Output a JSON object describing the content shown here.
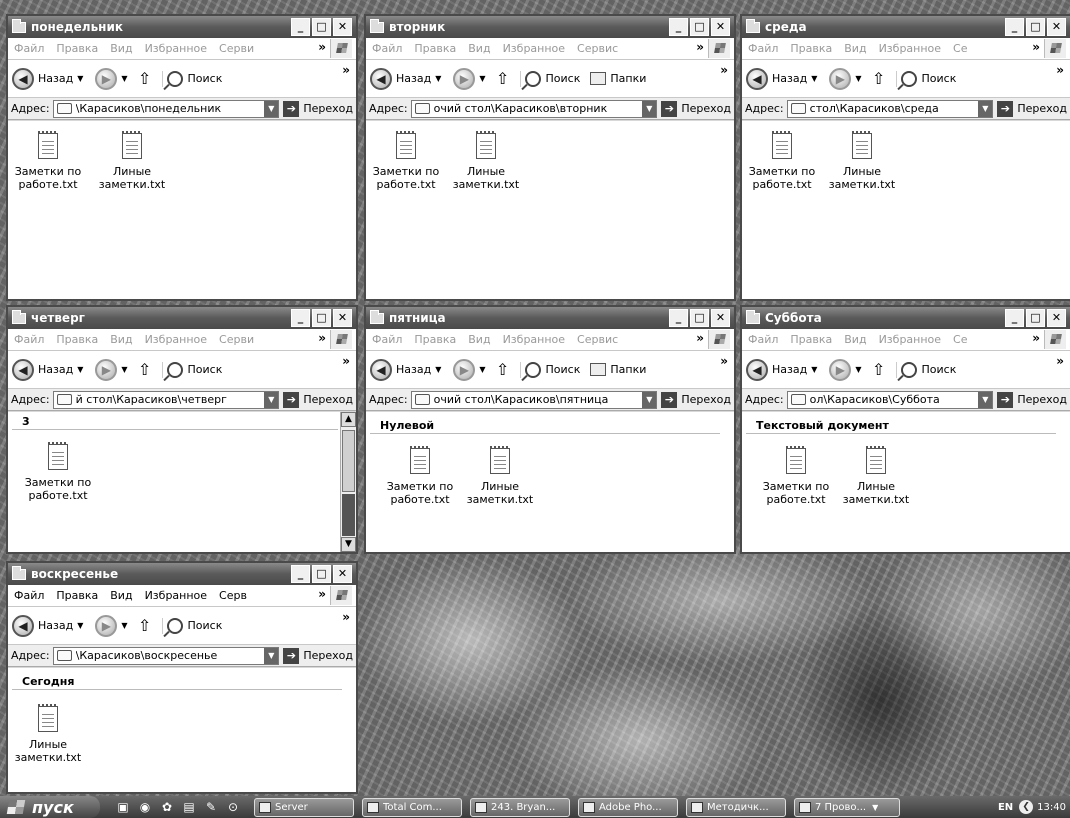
{
  "menu": {
    "file": "Файл",
    "edit": "Правка",
    "view": "Вид",
    "favorites": "Избранное"
  },
  "toolbar": {
    "back": "Назад",
    "search": "Поиск",
    "folders": "Папки",
    "more": "»"
  },
  "address": {
    "label": "Адрес:",
    "go": "Переход"
  },
  "windows": [
    {
      "title": "понедельник",
      "menu_service": "Серви",
      "address": "\\Карасиков\\понедельник",
      "group": "",
      "files": [
        {
          "line1": "Заметки по",
          "line2": "работе.txt"
        },
        {
          "line1": "Линые",
          "line2": "заметки.txt"
        }
      ]
    },
    {
      "title": "вторник",
      "menu_service": "Сервис",
      "address": "очий стол\\Карасиков\\вторник",
      "group": "",
      "files": [
        {
          "line1": "Заметки по",
          "line2": "работе.txt"
        },
        {
          "line1": "Линые",
          "line2": "заметки.txt"
        }
      ]
    },
    {
      "title": "среда",
      "menu_service": "Се",
      "address": "стол\\Карасиков\\среда",
      "group": "",
      "files": [
        {
          "line1": "Заметки по",
          "line2": "работе.txt"
        },
        {
          "line1": "Линые",
          "line2": "заметки.txt"
        }
      ]
    },
    {
      "title": "четверг",
      "menu_service": "Серви",
      "address": "й стол\\Карасиков\\четверг",
      "group": "3",
      "files": [
        {
          "line1": "Заметки по",
          "line2": "работе.txt"
        }
      ]
    },
    {
      "title": "пятница",
      "menu_service": "Сервис",
      "address": "очий стол\\Карасиков\\пятница",
      "group": "Нулевой",
      "files": [
        {
          "line1": "Заметки по",
          "line2": "работе.txt"
        },
        {
          "line1": "Линые",
          "line2": "заметки.txt"
        }
      ]
    },
    {
      "title": "Суббота",
      "menu_service": "Се",
      "address": "ол\\Карасиков\\Суббота",
      "group": "Текстовый документ",
      "files": [
        {
          "line1": "Заметки по",
          "line2": "работе.txt"
        },
        {
          "line1": "Линые",
          "line2": "заметки.txt"
        }
      ]
    },
    {
      "title": "воскресенье",
      "menu_service": "Серв",
      "address": "\\Карасиков\\воскресенье",
      "group": "Сегодня",
      "files": [
        {
          "line1": "Линые",
          "line2": "заметки.txt"
        }
      ]
    }
  ],
  "taskbar": {
    "start": "пуск",
    "buttons": [
      "Server",
      "Total Com...",
      "243. Bryan...",
      "Adobe Pho...",
      "Методичк...",
      "7 Прово..."
    ],
    "lang": "EN",
    "clock": "13:40"
  }
}
